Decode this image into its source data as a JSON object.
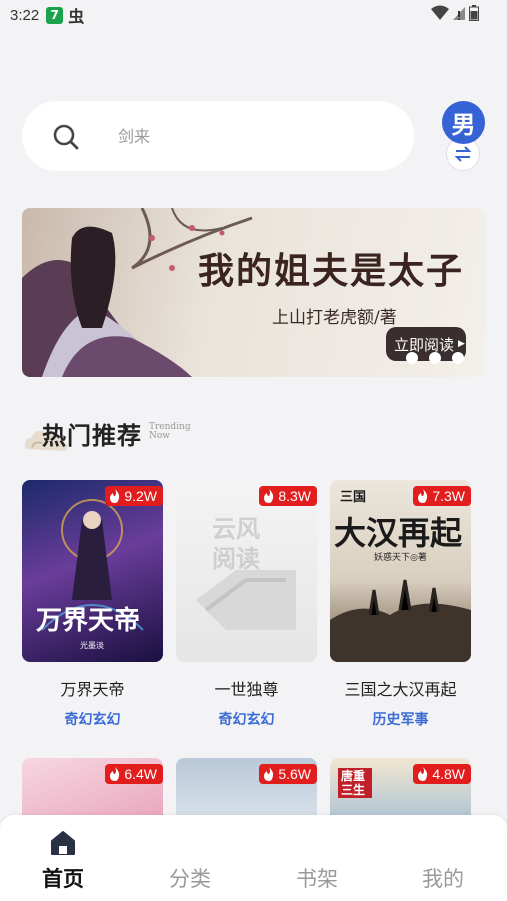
{
  "status_bar": {
    "time": "3:22",
    "app_badge": "7",
    "app_icon": "虫"
  },
  "search": {
    "placeholder": "剑来"
  },
  "gender_toggle": {
    "label": "男"
  },
  "banner": {
    "title": "我的姐夫是太子",
    "author": "上山打老虎额/著",
    "button_label": "立即阅读",
    "page_count": 3
  },
  "section": {
    "title": "热门推荐",
    "subtitle_line1": "Trending",
    "subtitle_line2": "Now"
  },
  "books": [
    {
      "title": "万界天帝",
      "genre": "奇幻玄幻",
      "hot": "9.2W",
      "cover_text": "万界天帝",
      "cover_small": "光墨淡"
    },
    {
      "title": "一世独尊",
      "genre": "奇幻玄幻",
      "hot": "8.3W",
      "cover_text": "云风阅读"
    },
    {
      "title": "三国之大汉再起",
      "genre": "历史军事",
      "hot": "7.3W",
      "cover_text": "大汉再起",
      "cover_small": "妖惑天下◎著",
      "cover_tag": "三国"
    },
    {
      "title": "",
      "genre": "",
      "hot": "6.4W"
    },
    {
      "title": "",
      "genre": "",
      "hot": "5.6W"
    },
    {
      "title": "",
      "genre": "",
      "hot": "4.8W",
      "cover_tag": "唐重三生"
    }
  ],
  "bottom_nav": [
    {
      "label": "首页",
      "active": true
    },
    {
      "label": "分类"
    },
    {
      "label": "书架"
    },
    {
      "label": "我的"
    }
  ],
  "colors": {
    "accent_blue": "#3563d6",
    "hot_red": "#e21d1d",
    "genre_blue": "#3a6bd6"
  }
}
